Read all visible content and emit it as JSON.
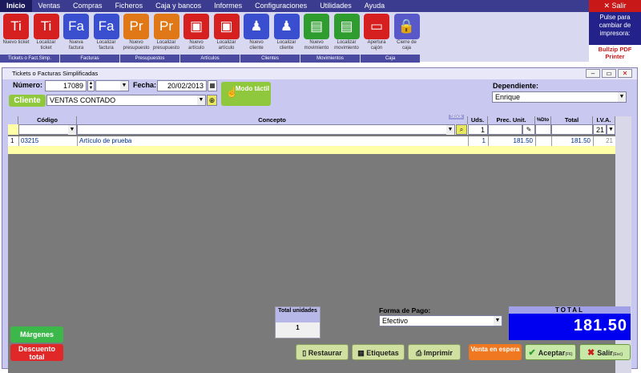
{
  "menu": [
    "Inicio",
    "Ventas",
    "Compras",
    "Ficheros",
    "Caja y bancos",
    "Informes",
    "Configuraciones",
    "Utilidades",
    "Ayuda"
  ],
  "top_right": {
    "salir": "Salir",
    "printer_prompt": "Pulse para cambiar de impresora:",
    "printer_name": "Bullzip PDF Printer"
  },
  "ribbon": {
    "buttons": [
      {
        "icon": "Ti",
        "label": "Nuevo ticket",
        "color": "#d62020"
      },
      {
        "icon": "Ti",
        "label": "Localizar ticket",
        "color": "#d62020"
      },
      {
        "icon": "Fa",
        "label": "Nueva factura",
        "color": "#3a4fd0"
      },
      {
        "icon": "Fa",
        "label": "Localizar factura",
        "color": "#3a4fd0"
      },
      {
        "icon": "Pr",
        "label": "Nuevo presupuesto",
        "color": "#e07818"
      },
      {
        "icon": "Pr",
        "label": "Localizar presupuesto",
        "color": "#e07818"
      },
      {
        "icon": "box",
        "label": "Nuevo artículo",
        "color": "#d62020"
      },
      {
        "icon": "box",
        "label": "Localizar artículo",
        "color": "#d62020"
      },
      {
        "icon": "people",
        "label": "Nuevo cliente",
        "color": "#3a4fd0"
      },
      {
        "icon": "people",
        "label": "Localizar cliente",
        "color": "#3a4fd0"
      },
      {
        "icon": "mov",
        "label": "Nuevo movimiento",
        "color": "#2e9c2e"
      },
      {
        "icon": "mov",
        "label": "Localizar movimiento",
        "color": "#2e9c2e"
      },
      {
        "icon": "drawer",
        "label": "Apertura cajón",
        "color": "#d62020"
      },
      {
        "icon": "lock",
        "label": "Cierre de caja",
        "color": "#5858c8"
      }
    ],
    "groups": [
      "Tickets o Fact.Simp.",
      "Facturas",
      "Presupuestos",
      "Artículos",
      "Clientes",
      "Movimientos",
      "Caja"
    ]
  },
  "window": {
    "title": "Tickets o Facturas Simplificadas"
  },
  "form": {
    "numero_label": "Número:",
    "numero": "17089",
    "fecha_label": "Fecha:",
    "fecha": "20/02/2013",
    "modo_tactil": "Modo táctil",
    "dependiente_label": "Dependiente:",
    "dependiente": "Enrique",
    "cliente_label": "Cliente",
    "cliente": "VENTAS CONTADO"
  },
  "grid": {
    "headers": [
      "Código",
      "Concepto",
      "Uds.",
      "Prec. Unit.",
      "%Dto",
      "Total",
      "I.V.A."
    ],
    "stock_label": "Stock",
    "input": {
      "uds": "1",
      "iva": "21"
    },
    "rows": [
      {
        "n": "1",
        "codigo": "03215",
        "concepto": "Artículo de prueba",
        "uds": "1",
        "precio": "181.50",
        "total": "181.50",
        "iva": "21"
      }
    ]
  },
  "footer": {
    "total_unidades_label": "Total unidades",
    "total_unidades": "1",
    "forma_pago_label": "Forma de Pago:",
    "forma_pago": "Efectivo",
    "total_label": "TOTAL",
    "total": "181.50",
    "margenes": "Márgenes",
    "descuento": "Descuento total",
    "restaurar": "Restaurar",
    "etiquetas": "Etiquetas",
    "imprimir": "Imprimir",
    "venta_espera": "Venta en espera",
    "aceptar": "Aceptar",
    "aceptar_key": "(F6)",
    "salir": "Salir",
    "salir_key": "(Esc)"
  }
}
